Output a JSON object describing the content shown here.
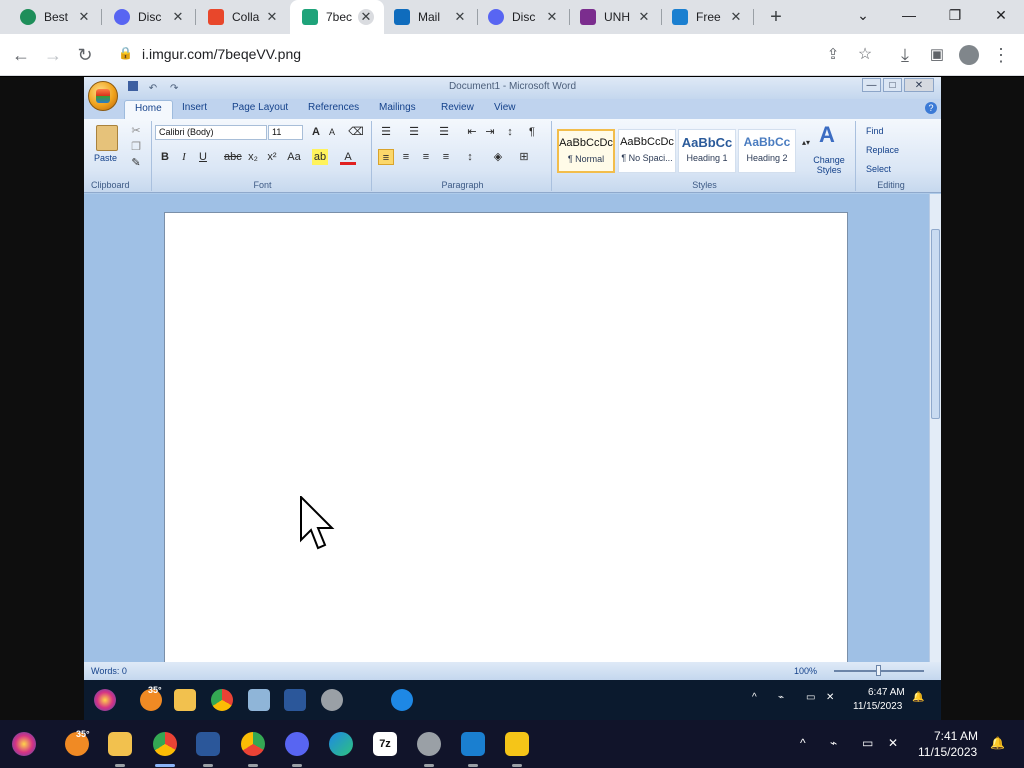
{
  "browser": {
    "tabs": [
      {
        "label": "Best",
        "color": "#1e8e5a"
      },
      {
        "label": "Disc",
        "color": "#5865f2"
      },
      {
        "label": "Colla",
        "color": "#e8472b"
      },
      {
        "label": "7bec",
        "color": "#1fa37a",
        "active": true
      },
      {
        "label": "Mail",
        "color": "#0f6cbd"
      },
      {
        "label": "Disc",
        "color": "#5865f2"
      },
      {
        "label": "UNH",
        "color": "#7b2d8e"
      },
      {
        "label": "Free",
        "color": "#1a7fd0"
      }
    ],
    "url": "i.imgur.com/7beqeVV.png"
  },
  "word": {
    "title": "Document1 - Microsoft Word",
    "ribbon_tabs": [
      "Home",
      "Insert",
      "Page Layout",
      "References",
      "Mailings",
      "Review",
      "View"
    ],
    "clipboard": {
      "paste_label": "Paste",
      "group_label": "Clipboard"
    },
    "font": {
      "name": "Calibri (Body)",
      "size": "11",
      "group_label": "Font"
    },
    "paragraph": {
      "group_label": "Paragraph"
    },
    "styles": {
      "tiles": [
        {
          "preview": "AaBbCcDc",
          "name": "¶ Normal"
        },
        {
          "preview": "AaBbCcDc",
          "name": "¶ No Spaci..."
        },
        {
          "preview": "AaBbCc",
          "name": "Heading 1"
        },
        {
          "preview": "AaBbCc",
          "name": "Heading 2"
        }
      ],
      "change_styles": "Change Styles",
      "group_label": "Styles"
    },
    "editing": {
      "find": "Find",
      "replace": "Replace",
      "select": "Select",
      "group_label": "Editing"
    },
    "status": {
      "words": "Words: 0",
      "zoom": "100%"
    }
  },
  "inner_taskbar": {
    "weather": "35°",
    "time": "6:47 AM",
    "date": "11/15/2023"
  },
  "taskbar": {
    "weather": "35°",
    "time": "7:41 AM",
    "date": "11/15/2023"
  }
}
